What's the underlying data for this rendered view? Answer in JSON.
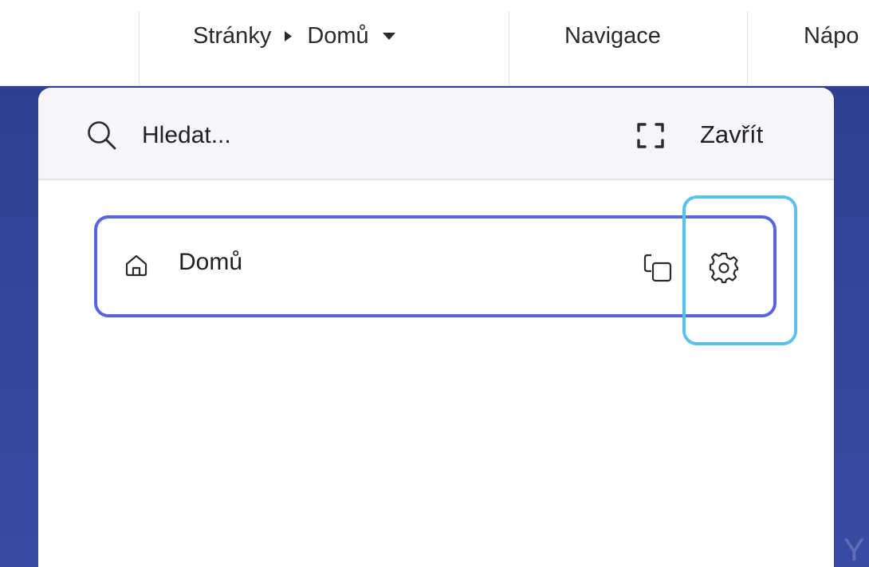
{
  "toolbar": {
    "breadcrumb_root": "Stránky",
    "breadcrumb_current": "Domů",
    "navigation_label": "Navigace",
    "help_label": "Nápo"
  },
  "panel": {
    "search": {
      "placeholder": "Hledat..."
    },
    "close_label": "Zavřít",
    "pages": [
      {
        "label": "Domů",
        "icon": "home-icon"
      }
    ]
  },
  "backdrop": {
    "partial_text": "Y"
  },
  "colors": {
    "row_border": "#5766e0",
    "highlight": "#5cc0ee",
    "backdrop": "#33449a",
    "panel_header": "#f6f6f8"
  }
}
